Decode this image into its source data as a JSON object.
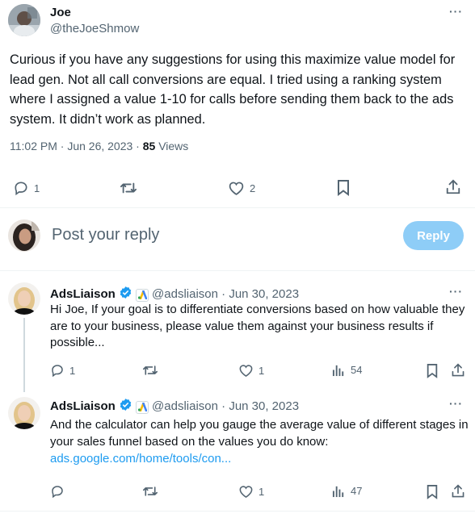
{
  "main_tweet": {
    "author_name": "Joe",
    "author_handle": "@theJoeShmow",
    "text": "Curious if you have any suggestions for using this maximize value model for lead gen. Not all call conversions are equal. I tried using a ranking system where I assigned a value 1-10 for calls before sending them back to the ads system. It didn’t work as planned.",
    "time": "11:02 PM · Jun 26, 2023 · ",
    "views_count": "85",
    "views_label": " Views",
    "replies": "1",
    "likes": "2",
    "more_label": "···"
  },
  "reply_box": {
    "placeholder": "Post your reply",
    "button_label": "Reply"
  },
  "replies": [
    {
      "author_name": "AdsLiaison",
      "author_handle": "@adsliaison",
      "separator": " · ",
      "date": "Jun 30, 2023",
      "text": "Hi Joe, If your goal is to differentiate conversions based on how valuable they are to your business, please value them against your business results if possible...",
      "link": "",
      "replies": "1",
      "likes": "1",
      "views": "54"
    },
    {
      "author_name": "AdsLiaison",
      "author_handle": "@adsliaison",
      "separator": " · ",
      "date": "Jun 30, 2023",
      "text": "And the calculator can help you gauge the average value of different stages in your sales funnel based on the values you do know:",
      "link": "ads.google.com/home/tools/con...",
      "replies": "",
      "likes": "1",
      "views": "47"
    }
  ],
  "colors": {
    "accent": "#1d9bf0",
    "reply_button_disabled": "#8ecdf7",
    "muted_text": "#536471",
    "divider": "#eff3f4"
  },
  "icons": [
    "reply-icon",
    "retweet-icon",
    "like-icon",
    "bookmark-icon",
    "share-icon",
    "views-icon",
    "verified-badge-icon",
    "google-ads-affiliate-icon",
    "more-icon"
  ]
}
